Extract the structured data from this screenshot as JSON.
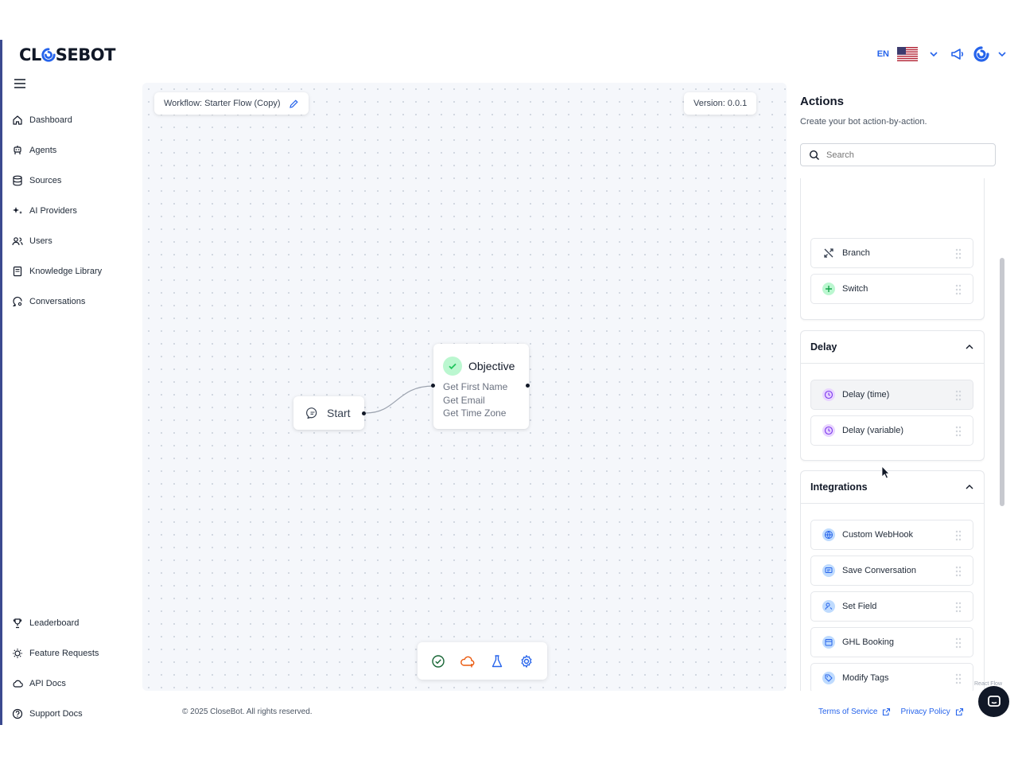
{
  "brand": {
    "logo_text_pre": "CL",
    "logo_text_post": "SEBOT"
  },
  "header": {
    "lang": "EN"
  },
  "nav": {
    "items": [
      {
        "label": "Dashboard"
      },
      {
        "label": "Agents"
      },
      {
        "label": "Sources"
      },
      {
        "label": "AI Providers"
      },
      {
        "label": "Users"
      },
      {
        "label": "Knowledge Library"
      },
      {
        "label": "Conversations"
      }
    ],
    "bottom": [
      {
        "label": "Leaderboard"
      },
      {
        "label": "Feature Requests"
      },
      {
        "label": "API Docs"
      },
      {
        "label": "Support Docs"
      }
    ]
  },
  "canvas": {
    "workflow_title": "Workflow: Starter Flow (Copy)",
    "version": "Version: 0.0.1",
    "start_node": {
      "label": "Start"
    },
    "objective_node": {
      "title": "Objective",
      "lines": [
        "Get First Name",
        "Get Email",
        "Get Time Zone"
      ]
    }
  },
  "panel": {
    "title": "Actions",
    "subtitle": "Create your bot action-by-action.",
    "search_placeholder": "Search",
    "top_items": [
      {
        "label": "Branch"
      },
      {
        "label": "Switch"
      }
    ],
    "delay": {
      "title": "Delay",
      "items": [
        {
          "label": "Delay (time)"
        },
        {
          "label": "Delay (variable)"
        }
      ]
    },
    "integrations": {
      "title": "Integrations",
      "items": [
        {
          "label": "Custom WebHook"
        },
        {
          "label": "Save Conversation"
        },
        {
          "label": "Set Field"
        },
        {
          "label": "GHL Booking"
        },
        {
          "label": "Modify Tags"
        }
      ]
    },
    "react_flow_label": "React Flow"
  },
  "footer": {
    "copyright": "© 2025 CloseBot. All rights reserved.",
    "terms": "Terms of Service",
    "privacy": "Privacy Policy"
  },
  "colors": {
    "accent": "#2563eb",
    "sidebar_border": "#3b4a8f",
    "success": "#22c55e"
  }
}
